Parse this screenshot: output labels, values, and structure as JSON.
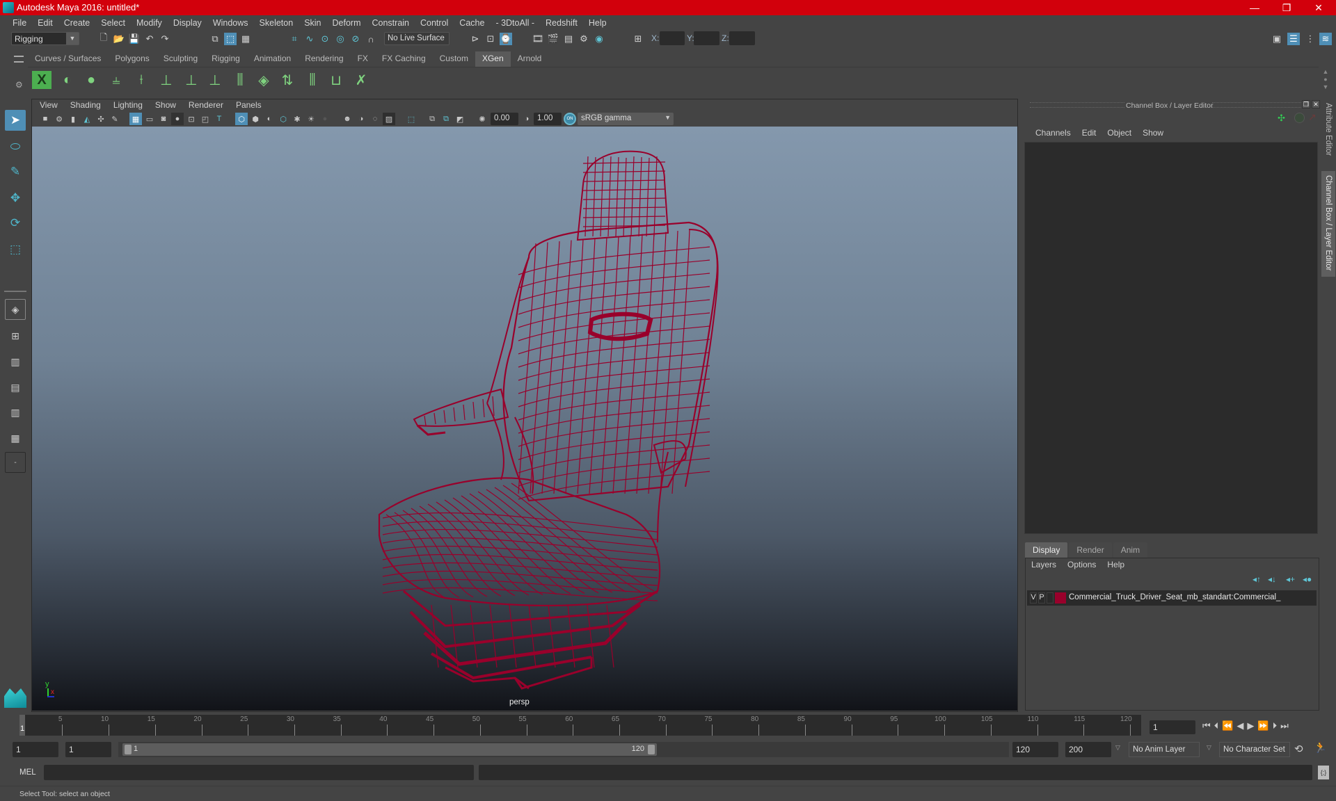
{
  "window": {
    "title": "Autodesk Maya 2016: untitled*",
    "controls": {
      "minimize": "—",
      "restore": "❐",
      "close": "✕"
    }
  },
  "menubar": [
    "File",
    "Edit",
    "Create",
    "Select",
    "Modify",
    "Display",
    "Windows",
    "Skeleton",
    "Skin",
    "Deform",
    "Constrain",
    "Control",
    "Cache",
    "- 3DtoAll -",
    "Redshift",
    "Help"
  ],
  "toolbar": {
    "mode_selected": "Rigging",
    "live_surface": "No Live Surface",
    "coord_labels": {
      "x": "X:",
      "y": "Y:",
      "z": "Z:"
    },
    "coord_values": {
      "x": "",
      "y": "",
      "z": ""
    }
  },
  "shelf": {
    "tabs": [
      "Curves / Surfaces",
      "Polygons",
      "Sculpting",
      "Rigging",
      "Animation",
      "Rendering",
      "FX",
      "FX Caching",
      "Custom",
      "XGen",
      "Arnold"
    ],
    "active_tab": "XGen",
    "icons": [
      "xgen-window-icon",
      "xgen-preview-icon",
      "xgen-clear-preview-icon",
      "xgen-add-guides-icon",
      "xgen-sculpt-guides-icon",
      "xgen-place-guide-icon",
      "xgen-move-guide-icon",
      "xgen-rotate-guide-icon",
      "xgen-lock-guide-icon",
      "xgen-comb-guides-icon",
      "xgen-guide-layers-icon",
      "xgen-cut-guides-icon",
      "xgen-select-guides-icon",
      "xgen-guide-length-icon",
      "xgen-delete-guides-icon"
    ]
  },
  "left_tools": [
    "select-tool",
    "lasso-tool",
    "paint-select-tool",
    "move-tool",
    "rotate-tool",
    "scale-tool"
  ],
  "viewport": {
    "menu": [
      "View",
      "Shading",
      "Lighting",
      "Show",
      "Renderer",
      "Panels"
    ],
    "exposure": "0.00",
    "gamma": "1.00",
    "color_space": "sRGB gamma",
    "color_mgmt_label": "ON",
    "camera_label": "persp",
    "axis": {
      "x": "x",
      "y": "y",
      "z": "z"
    },
    "model_color": "#99002b"
  },
  "channel_box": {
    "title": "Channel Box / Layer Editor",
    "menu": [
      "Channels",
      "Edit",
      "Object",
      "Show"
    ]
  },
  "layer_editor": {
    "tabs": [
      "Display",
      "Render",
      "Anim"
    ],
    "active_tab": "Display",
    "menu": [
      "Layers",
      "Options",
      "Help"
    ],
    "layers": [
      {
        "v": "V",
        "p": "P",
        "color": "#99002b",
        "name": "Commercial_Truck_Driver_Seat_mb_standart:Commercial_"
      }
    ]
  },
  "side_tabs": [
    "Attribute Editor",
    "Channel Box / Layer Editor"
  ],
  "timeline": {
    "ticks": [
      "5",
      "10",
      "15",
      "20",
      "25",
      "30",
      "35",
      "40",
      "45",
      "50",
      "55",
      "60",
      "65",
      "70",
      "75",
      "80",
      "85",
      "90",
      "95",
      "100",
      "105",
      "110",
      "115",
      "120"
    ],
    "current_frame_marker": "1",
    "current_frame": "1"
  },
  "range": {
    "start": "1",
    "playback_start": "1",
    "slider_start": "1",
    "slider_end": "120",
    "playback_end": "120",
    "end": "200",
    "anim_layer": "No Anim Layer",
    "character_set": "No Character Set"
  },
  "command_line": {
    "label": "MEL",
    "value": "",
    "result": ""
  },
  "status": {
    "help_line": "Select Tool: select an object"
  }
}
